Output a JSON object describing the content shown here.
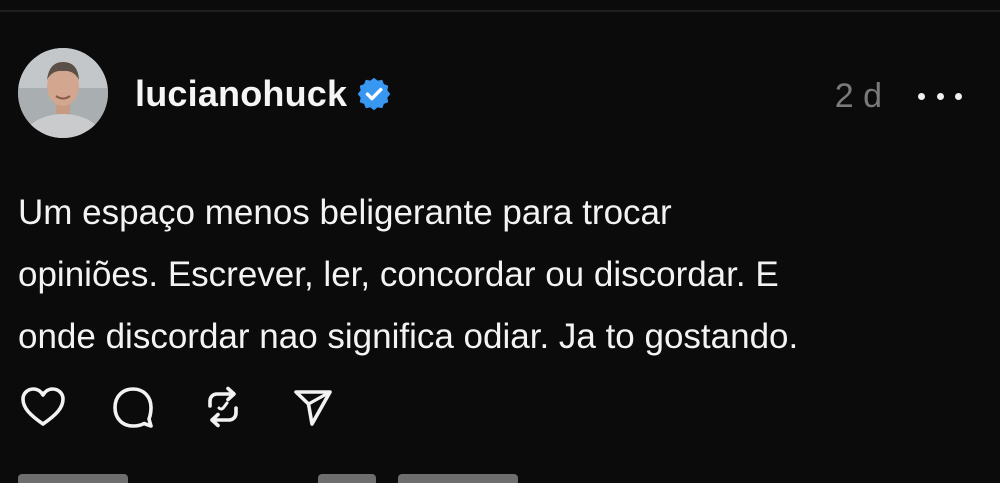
{
  "post": {
    "username": "lucianohuck",
    "verified": true,
    "timestamp": "2 d",
    "text": "Um espaço menos beligerante para trocar\nopiniões. Escrever, ler, concordar ou discordar. E\nonde discordar nao significa odiar. Ja to gostando.",
    "avatar_icon": "profile-photo",
    "accent_color": "#3897f0"
  },
  "actions": [
    {
      "icon": "heart-icon"
    },
    {
      "icon": "comment-icon"
    },
    {
      "icon": "repost-icon"
    },
    {
      "icon": "share-icon"
    }
  ],
  "more_icon": "more-horizontal-icon"
}
